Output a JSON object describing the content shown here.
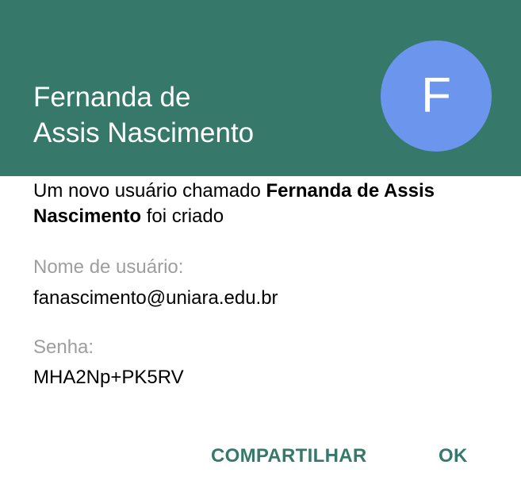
{
  "header": {
    "user_name_line1": "Fernanda de",
    "user_name_line2": "Assis Nascimento",
    "avatar_letter": "F",
    "background_color": "#36796a",
    "avatar_color": "#6c96ee"
  },
  "message": {
    "prefix": "Um novo usuário chamado ",
    "name": "Fernanda de Assis Nascimento",
    "suffix": " foi criado"
  },
  "fields": {
    "username_label": "Nome de usuário:",
    "username_value": "fanascimento@uniara.edu.br",
    "password_label": "Senha:",
    "password_value": "MHA2Np+PK5RV"
  },
  "actions": {
    "share_label": "COMPARTILHAR",
    "ok_label": "OK",
    "accent_color": "#36796a"
  }
}
